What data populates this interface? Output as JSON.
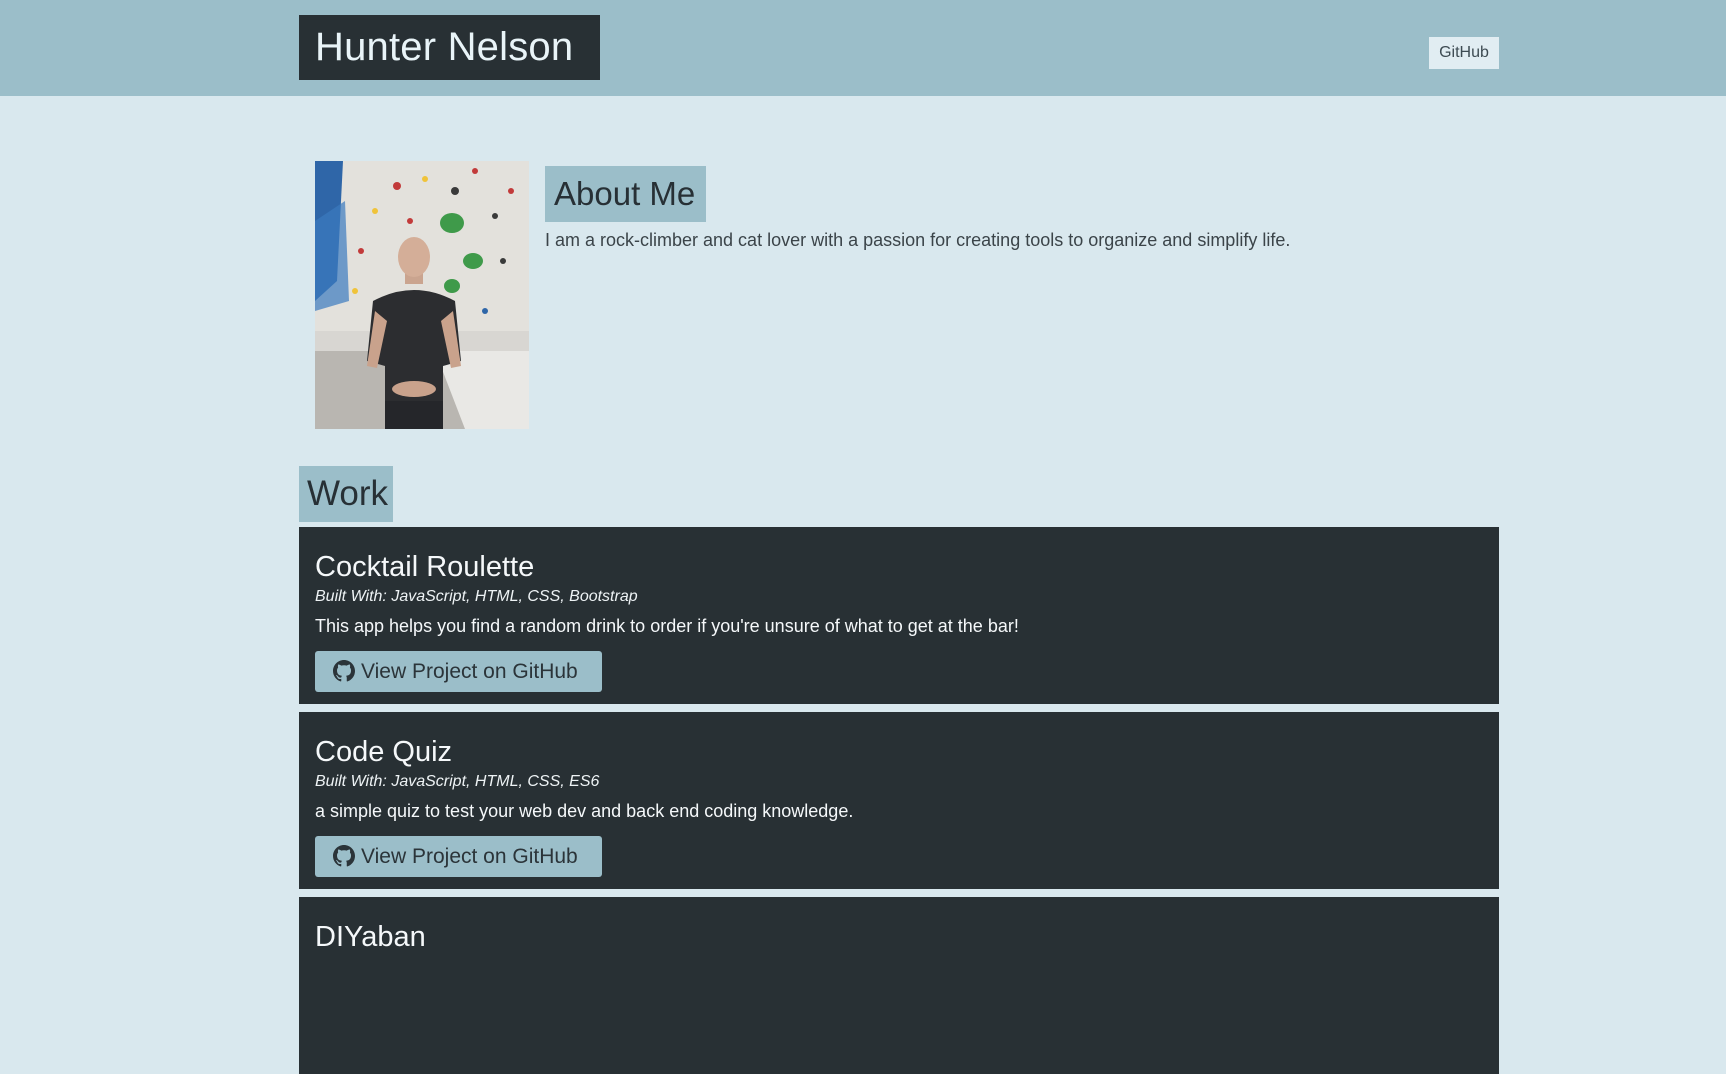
{
  "header": {
    "brand": "Hunter Nelson",
    "nav_github": "GitHub",
    "background": "#9bbec9"
  },
  "about": {
    "heading": "About Me",
    "text": "I am a rock-climber and cat lover with a passion for creating tools to organize and simplify life.",
    "photo_icon": "profile-photo"
  },
  "work": {
    "heading": "Work",
    "projects": [
      {
        "title": "Cocktail Roulette",
        "built_with": "Built With: JavaScript, HTML, CSS, Bootstrap",
        "description": "This app helps you find a random drink to order if you're unsure of what to get at the bar!",
        "button": "View Project on GitHub",
        "icon": "github-icon"
      },
      {
        "title": "Code Quiz",
        "built_with": "Built With: JavaScript, HTML, CSS, ES6",
        "description": "a simple quiz to test your web dev and back end coding knowledge.",
        "button": "View Project on GitHub",
        "icon": "github-icon"
      },
      {
        "title": "DIYaban",
        "built_with": "",
        "description": "",
        "button": "",
        "icon": ""
      }
    ]
  },
  "colors": {
    "page_bg": "#d9e8ee",
    "accent": "#9bbec9",
    "dark": "#283034"
  }
}
